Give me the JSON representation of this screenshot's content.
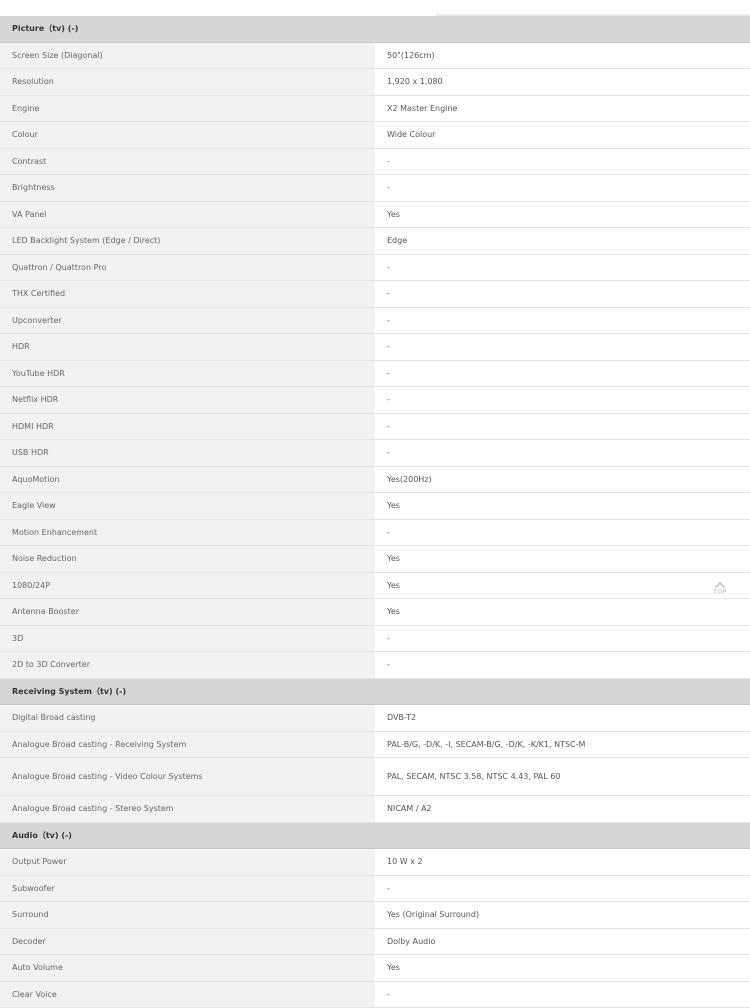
{
  "sections": {
    "picture": {
      "title": "Picture（tv) (-)"
    },
    "receiving": {
      "title": "Receiving System（tv) (-)"
    },
    "audio": {
      "title": "Audio（tv) (-)"
    }
  },
  "rows": {
    "screen_size": {
      "label": "Screen Size (Diagonal)",
      "value": "50\"(126cm)"
    },
    "resolution": {
      "label": "Resolution",
      "value": "1,920 x 1,080"
    },
    "engine": {
      "label": "Engine",
      "value": "X2 Master Engine"
    },
    "colour": {
      "label": "Colour",
      "value": "Wide Colour"
    },
    "contrast": {
      "label": "Contrast",
      "value": "-"
    },
    "brightness": {
      "label": "Brightness",
      "value": "-"
    },
    "va_panel": {
      "label": "VA Panel",
      "value": "Yes"
    },
    "led_backlight": {
      "label": "LED Backlight System (Edge / Direct)",
      "value": "Edge"
    },
    "quattron": {
      "label": "Quattron / Quattron Pro",
      "value": "-"
    },
    "thx": {
      "label": "THX Certified",
      "value": "-"
    },
    "upconverter": {
      "label": "Upconverter",
      "value": "-"
    },
    "hdr": {
      "label": "HDR",
      "value": "-"
    },
    "youtube_hdr": {
      "label": "YouTube HDR",
      "value": "-"
    },
    "netflix_hdr": {
      "label": "Netflix HDR",
      "value": "-"
    },
    "hdmi_hdr": {
      "label": "HDMI HDR",
      "value": "-"
    },
    "usb_hdr": {
      "label": "USB HDR",
      "value": "-"
    },
    "aquomotion": {
      "label": "AquoMotion",
      "value": "Yes(200Hz)"
    },
    "eagle_view": {
      "label": "Eagle View",
      "value": "Yes"
    },
    "motion_enh": {
      "label": "Motion Enhancement",
      "value": "-"
    },
    "noise_reduction": {
      "label": "Noise Reduction",
      "value": "Yes"
    },
    "p1080_24": {
      "label": "1080/24P",
      "value": "Yes"
    },
    "antenna_booster": {
      "label": "Antenna Booster",
      "value": "Yes"
    },
    "d3": {
      "label": "3D",
      "value": "-"
    },
    "d2_to_3d": {
      "label": "2D to 3D Converter",
      "value": "-"
    },
    "digital_bc": {
      "label": "Digital Broad casting",
      "value": "DVB-T2"
    },
    "analogue_recv": {
      "label": "Analogue Broad casting - Receiving System",
      "value": "PAL-B/G, -D/K, -I, SECAM-B/G, -D/K, -K/K1, NTSC-M"
    },
    "analogue_video": {
      "label": "Analogue Broad casting - Video Colour Systems",
      "value": "PAL, SECAM, NTSC 3.58, NTSC 4.43, PAL 60"
    },
    "analogue_stereo": {
      "label": "Analogue Broad casting - Stereo System",
      "value": "NICAM / A2"
    },
    "output_power": {
      "label": "Output Power",
      "value": "10 W x 2"
    },
    "subwoofer": {
      "label": "Subwoofer",
      "value": "-"
    },
    "surround": {
      "label": "Surround",
      "value": "Yes (Original Surround)"
    },
    "decoder": {
      "label": "Decoder",
      "value": "Dolby Audio"
    },
    "auto_volume": {
      "label": "Auto Volume",
      "value": "Yes"
    },
    "clear_voice": {
      "label": "Clear Voice",
      "value": "-"
    }
  },
  "top_button": {
    "label": "TOP",
    "icon": "chevron-up-icon"
  }
}
